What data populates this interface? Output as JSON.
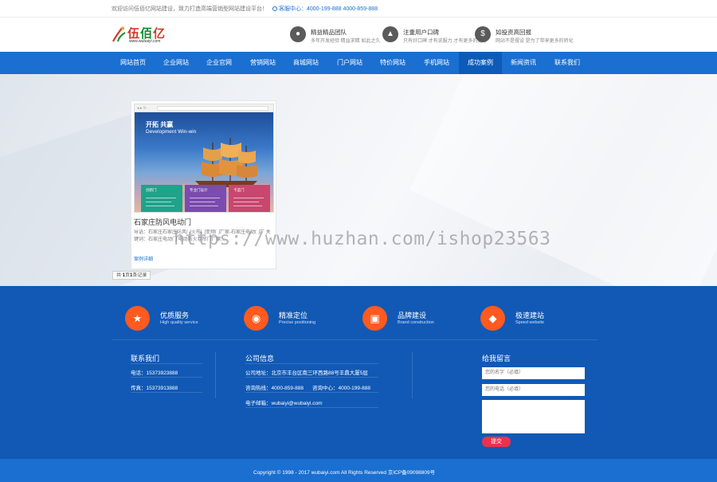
{
  "topbar": {
    "welcome": "欢迎访问伍佰亿网站建设，致力打造高端营销型网站建设平台！",
    "phone_label": "客服中心：",
    "phones": "4000-199-888 4000-859-888"
  },
  "header": {
    "logo_text_a": "伍",
    "logo_text_b": "佰",
    "logo_text_c": "亿",
    "logo_domain": "www.wubaiyi.com",
    "features": [
      {
        "title": "精益精品团队",
        "desc": "多年开发经验 精益求精 如此之久"
      },
      {
        "title": "注重用户口碑",
        "desc": "只有好口碑 才有说服力 才有更多的更好"
      },
      {
        "title": "如投资高回报",
        "desc": "网站不是摆设 是为了带来更多的转化"
      }
    ]
  },
  "nav": {
    "items": [
      "网站首页",
      "企业网站",
      "企业官网",
      "营销网站",
      "商城网站",
      "门户网站",
      "特价网站",
      "手机网站",
      "成功案例",
      "新闻资讯",
      "联系我们"
    ],
    "active_index": 8
  },
  "case": {
    "thumb_heading": "开拓 共赢",
    "thumb_subheading": "Development Win-win",
    "thumb_boxes": [
      "创新门",
      "专业门设计",
      "卡蓝门"
    ],
    "title": "石家庄防风电动门",
    "desc": "导语：石家庄石家庄防风门火布门变频门厂家-石家庄电动门厂 关键词：石家庄电动门 电动防火卷帘门厂家...",
    "more": "案例详细"
  },
  "pager": {
    "prefix": "共 ",
    "count": "1",
    "mid": "页",
    "records": "1",
    "suffix": "条记录"
  },
  "watermark": "https://www.huzhan.com/ishop23563",
  "services": [
    {
      "title": "优质服务",
      "desc": "High quality service",
      "icon": "star-icon"
    },
    {
      "title": "精准定位",
      "desc": "Precise positioning",
      "icon": "location-pin-icon"
    },
    {
      "title": "品牌建设",
      "desc": "Brand construction",
      "icon": "cube-icon"
    },
    {
      "title": "极速建站",
      "desc": "Speed website",
      "icon": "diamond-icon"
    }
  ],
  "contact": {
    "title": "联系我们",
    "lines": [
      "电话：15373923888",
      "传真：15373913888"
    ]
  },
  "company": {
    "title": "公司信息",
    "address": "公司地址：北京市丰台区南三环西路88号丰鼎大厦5层",
    "hotline_a": "咨询热线：4000-859-888",
    "hotline_b": "咨询中心：4000-199-888",
    "email": "电子邮箱：wubaiyi@wubaiyi.com"
  },
  "message": {
    "title": "给我留言",
    "name_placeholder": "您的名字（必填）",
    "phone_placeholder": "您的电话（必填）",
    "submit": "提交"
  },
  "copyright": "Copyright © 1998 - 2017 wubaiyi.com All Rights Reserved    京ICP备09098809号",
  "colors": {
    "primary": "#1a6fd1",
    "footer": "#1159b5",
    "accent": "#ff5a1f",
    "submit": "#e8334a"
  }
}
